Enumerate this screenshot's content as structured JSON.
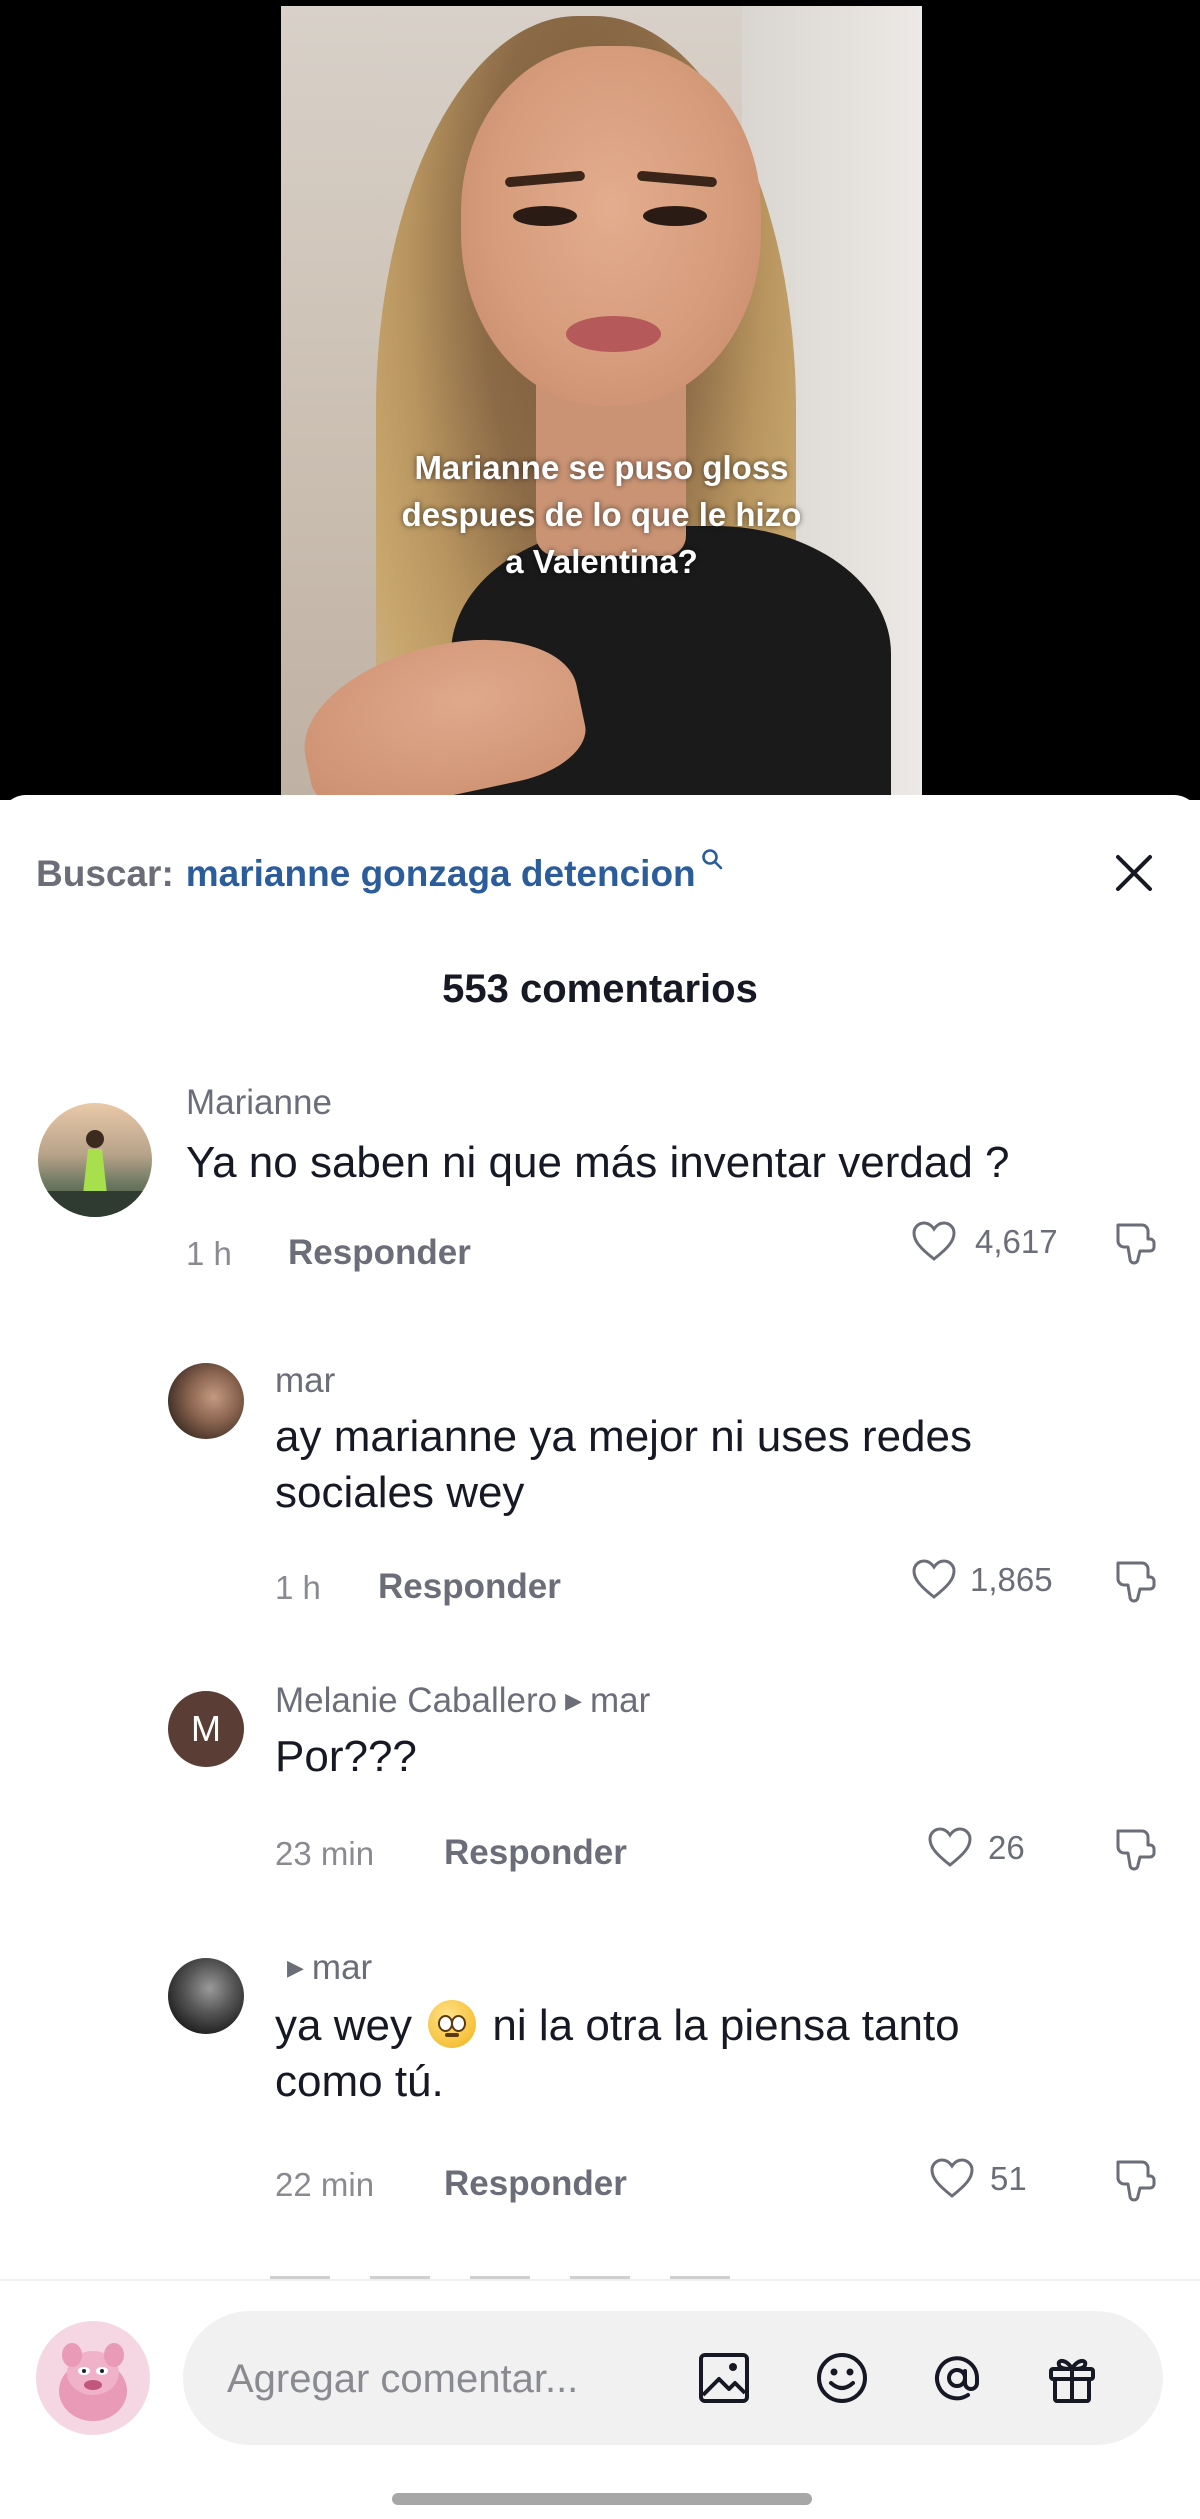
{
  "video": {
    "caption_lines": [
      "Marianne se puso gloss",
      "despues de lo que le hizo",
      "a Valentina?"
    ]
  },
  "search": {
    "prefix": "Buscar:",
    "term": "marianne gonzaga detencion"
  },
  "comments_header": {
    "title": "553 comentarios"
  },
  "comments": [
    {
      "user": "Marianne",
      "text": "Ya no saben ni que más inventar verdad ?",
      "time": "1 h",
      "reply_label": "Responder",
      "likes": "4,617"
    },
    {
      "user": "mar",
      "text_line1": "ay marianne ya mejor ni uses redes",
      "text_line2": "sociales wey",
      "time": "1 h",
      "reply_label": "Responder",
      "likes": "1,865"
    },
    {
      "user": "Melanie Caballero",
      "reply_to": "mar",
      "avatar_letter": "M",
      "text": "Por???",
      "time": "23 min",
      "reply_label": "Responder",
      "likes": "26"
    },
    {
      "user": "",
      "reply_to": "mar",
      "text_part1": "ya wey",
      "text_part2": "ni la otra la piensa tanto",
      "text_line2": "como tú.",
      "emoji": "face-with-rolling-eyes",
      "time": "22 min",
      "reply_label": "Responder",
      "likes": "51"
    }
  ],
  "composer": {
    "placeholder": "Agregar comentar..."
  },
  "colors": {
    "search_term": "#2b5c9b",
    "muted_text": "#6b6e78",
    "melanie_avatar": "#5a3d35"
  }
}
